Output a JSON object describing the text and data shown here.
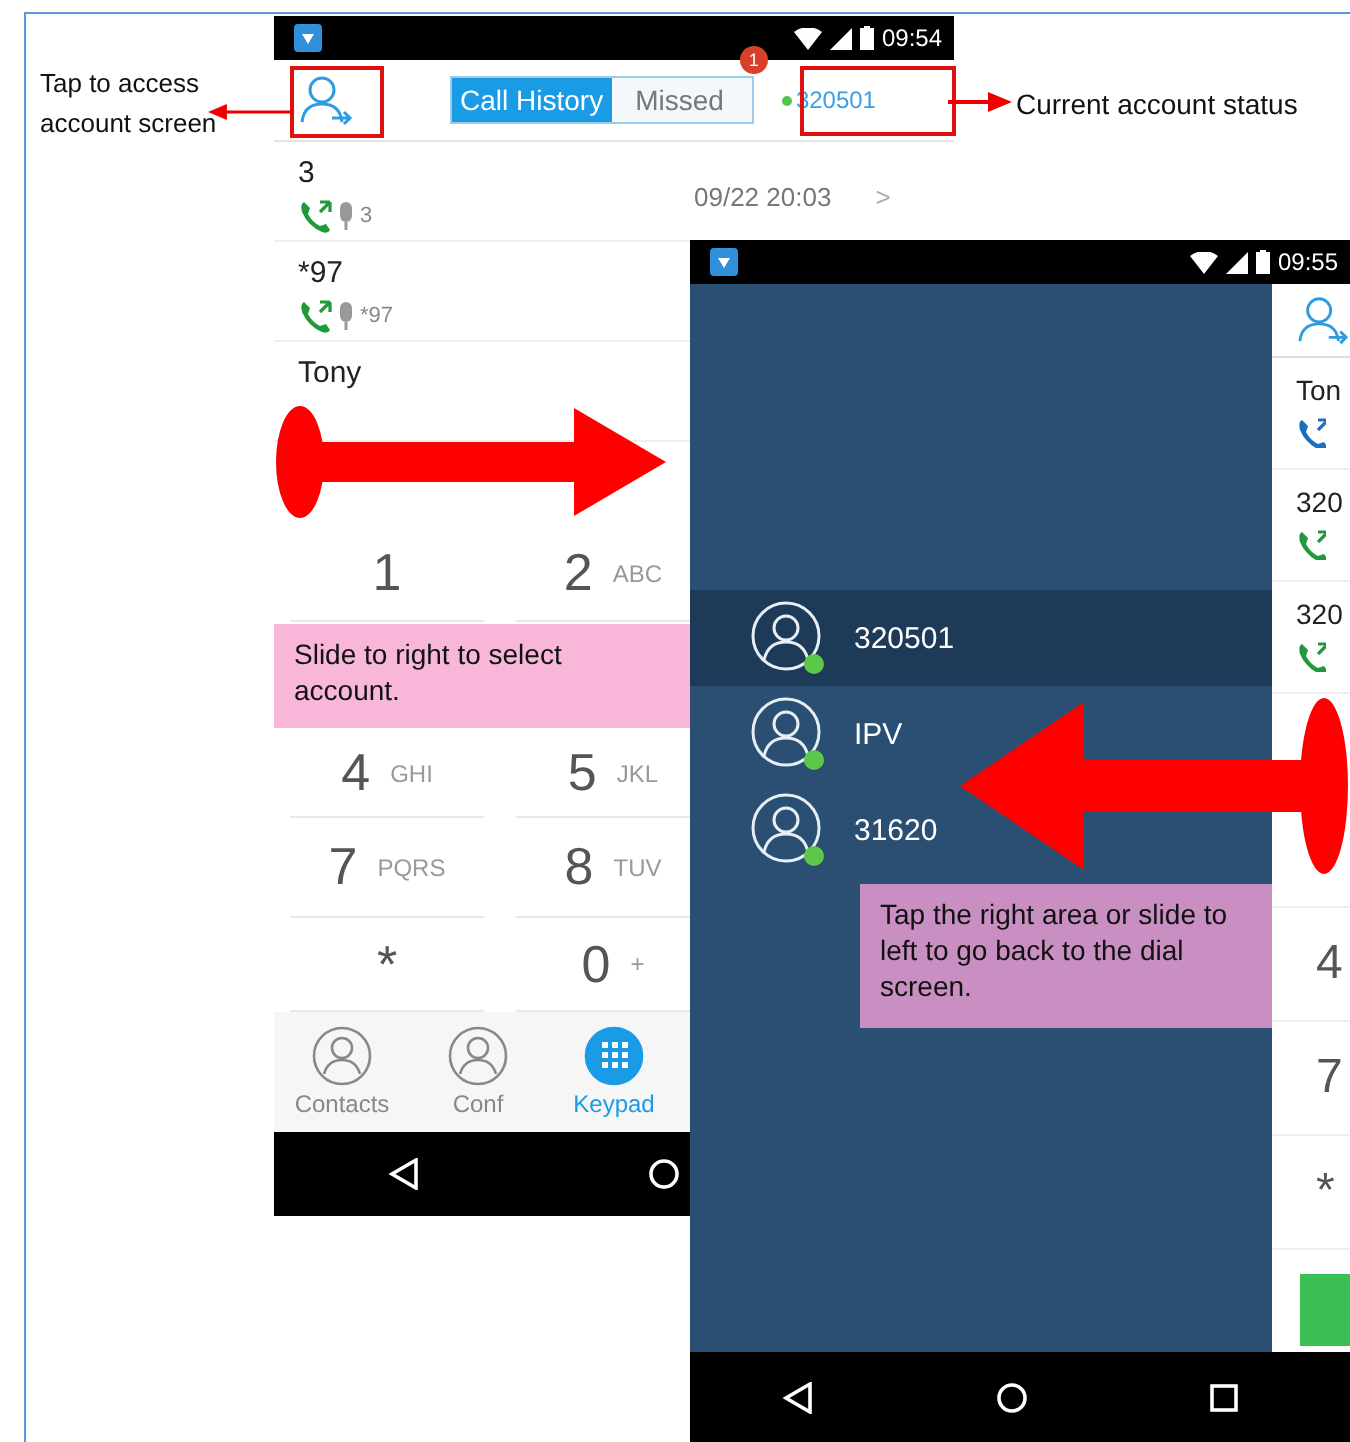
{
  "annotations": {
    "account_hint": "Tap to access account screen",
    "status_hint": "Current account status",
    "slide_right_hint": "Slide to right to select account.",
    "slide_left_hint": "Tap the right area or slide to left to go back to the dial screen."
  },
  "dial_screen": {
    "status_time": "09:54",
    "tabs": [
      {
        "label": "Call History",
        "selected": true
      },
      {
        "label": "Missed",
        "selected": false,
        "badge": "1"
      }
    ],
    "account_status": {
      "label": "320501",
      "online": true
    },
    "calls": [
      {
        "name": "3",
        "detail": "3",
        "time": "09/22 20:03",
        "chevron": ">"
      },
      {
        "name": "*97",
        "detail": "*97"
      },
      {
        "name": "Tony"
      }
    ],
    "keypad": [
      {
        "digit": "1"
      },
      {
        "digit": "2",
        "letters": "ABC"
      },
      {
        "digit": "4",
        "letters": "GHI"
      },
      {
        "digit": "5",
        "letters": "JKL"
      },
      {
        "digit": "7",
        "letters": "PQRS"
      },
      {
        "digit": "8",
        "letters": "TUV"
      },
      {
        "digit": "*"
      },
      {
        "digit": "0",
        "letters": "+"
      }
    ],
    "nav": [
      {
        "label": "Contacts",
        "selected": false
      },
      {
        "label": "Conf",
        "selected": false
      },
      {
        "label": "Keypad",
        "selected": true
      }
    ]
  },
  "account_screen": {
    "status_time": "09:55",
    "accounts": [
      {
        "name": "320501",
        "selected": true,
        "online": true
      },
      {
        "name": "IPV",
        "selected": false,
        "online": true
      },
      {
        "name": "31620",
        "selected": false,
        "online": true
      }
    ],
    "behind_names": [
      "Ton",
      "320",
      "320"
    ],
    "behind_keys": [
      "4",
      "7",
      "*"
    ]
  }
}
